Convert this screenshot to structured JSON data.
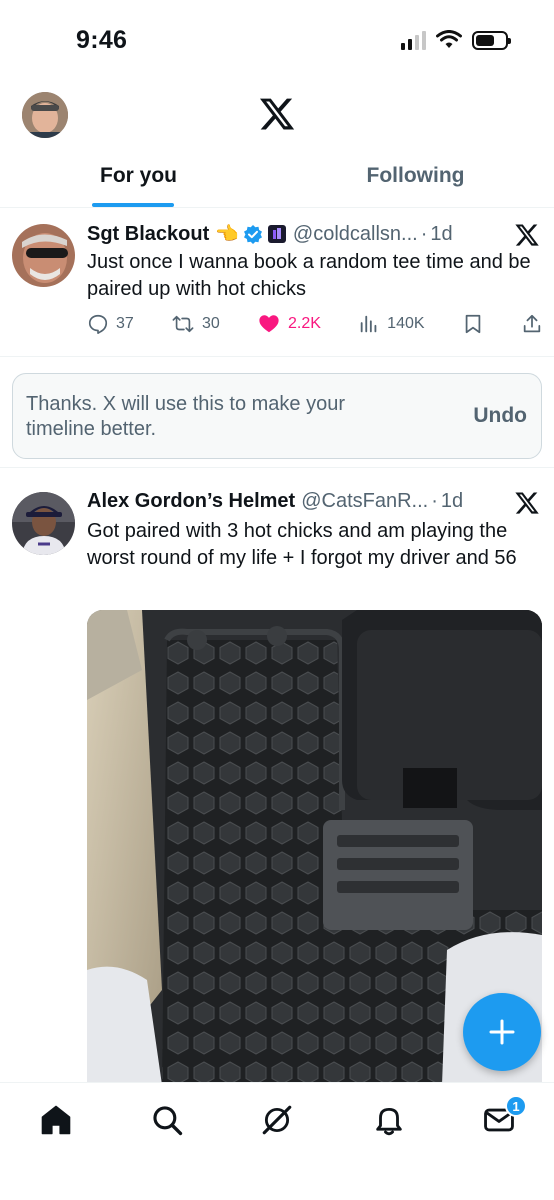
{
  "status_bar": {
    "time": "9:46",
    "battery_level": 0.65
  },
  "header": {
    "logo": "x-logo-icon"
  },
  "tabs": [
    {
      "label": "For you",
      "active": true
    },
    {
      "label": "Following",
      "active": false
    }
  ],
  "tweets": [
    {
      "name": "Sgt Blackout",
      "name_emoji": "👈",
      "handle": "@coldcallsn...",
      "dot": "·",
      "time": "1d",
      "text": "Just once I wanna book a random tee time and be paired up with hot chicks",
      "replies": "37",
      "reposts": "30",
      "likes": "2.2K",
      "views": "140K",
      "liked": true
    },
    {
      "name": "Alex Gordon’s Helmet",
      "handle": "@CatsFanR...",
      "dot": "·",
      "time": "1d",
      "text": "Got paired with 3 hot chicks and am playing the worst round of my life + I forgot my driver and 56"
    }
  ],
  "feedback": {
    "message": "Thanks. X will use this to make your timeline better.",
    "undo_label": "Undo"
  },
  "bottom_nav": {
    "items": [
      "home-icon",
      "search-icon",
      "grok-icon",
      "notifications-icon",
      "messages-icon"
    ],
    "messages_badge": "1"
  },
  "colors": {
    "accent": "#1d9bf0",
    "like": "#f91880",
    "secondary_text": "#536471"
  }
}
